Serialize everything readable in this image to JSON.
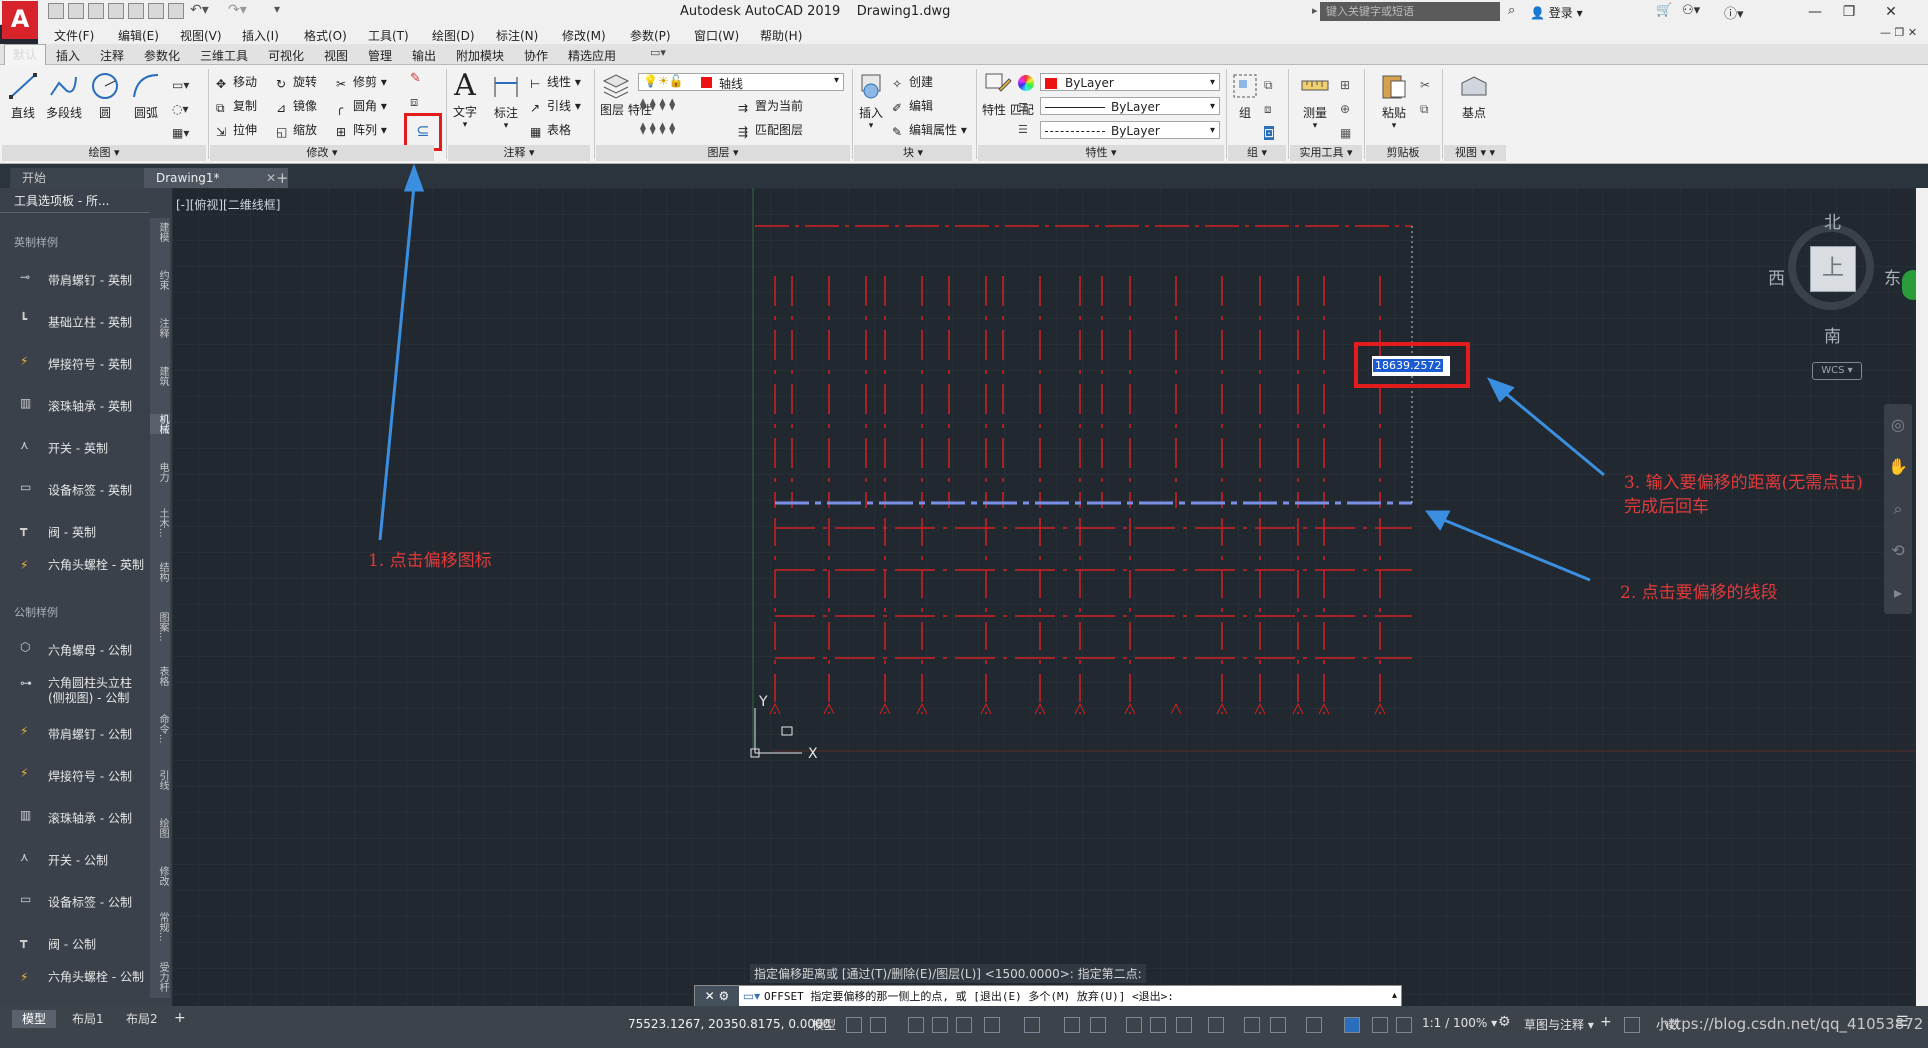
{
  "titlebar": {
    "app": "Autodesk AutoCAD 2019",
    "file": "Drawing1.dwg",
    "search_placeholder": "键入关键字或短语",
    "login": "登录"
  },
  "menu": [
    "文件(F)",
    "编辑(E)",
    "视图(V)",
    "插入(I)",
    "格式(O)",
    "工具(T)",
    "绘图(D)",
    "标注(N)",
    "修改(M)",
    "参数(P)",
    "窗口(W)",
    "帮助(H)"
  ],
  "ribbon_tabs": [
    "默认",
    "插入",
    "注释",
    "参数化",
    "三维工具",
    "可视化",
    "视图",
    "管理",
    "输出",
    "附加模块",
    "协作",
    "精选应用"
  ],
  "ribbon": {
    "draw": {
      "line": "直线",
      "polyline": "多段线",
      "circle": "圆",
      "arc": "圆弧",
      "title": "绘图"
    },
    "modify": {
      "move": "移动",
      "rotate": "旋转",
      "trim": "修剪",
      "copy": "复制",
      "mirror": "镜像",
      "fillet": "圆角",
      "stretch": "拉伸",
      "scale": "缩放",
      "array": "阵列",
      "title": "修改"
    },
    "annotation": {
      "text": "文字",
      "dimension": "标注",
      "linear": "线性",
      "leader": "引线",
      "table": "表格",
      "title": "注释"
    },
    "layers": {
      "properties": "图层\n特性",
      "current_layer": "轴线",
      "make_current": "置为当前",
      "match_layer": "匹配图层",
      "title": "图层"
    },
    "block": {
      "insert": "插入",
      "create": "创建",
      "edit": "编辑",
      "edit_attr": "编辑属性",
      "title": "块"
    },
    "properties": {
      "match": "特性\n匹配",
      "color": "ByLayer",
      "linetype": "ByLayer",
      "lineweight": "ByLayer",
      "title": "特性"
    },
    "groups": {
      "group": "组",
      "title": "组"
    },
    "utilities": {
      "measure": "测量",
      "title": "实用工具"
    },
    "clipboard": {
      "paste": "粘贴",
      "title": "剪贴板"
    },
    "view": {
      "base": "基点",
      "title": "视图"
    }
  },
  "file_tabs": [
    "开始",
    "Drawing1*"
  ],
  "viewport_label": "[-][俯视][二维线框]",
  "palette": {
    "title": "工具选项板 - 所...",
    "section_imperial": "英制样例",
    "imperial_items": [
      "带肩螺钉 - 英制",
      "基础立柱 - 英制",
      "焊接符号 - 英制",
      "滚珠轴承 - 英制",
      "开关 - 英制",
      "设备标签 - 英制",
      "阀 - 英制",
      "六角头螺栓 - 英制"
    ],
    "section_metric": "公制样例",
    "metric_items": [
      "六角螺母 - 公制",
      "六角圆柱头立柱 (侧视图) - 公制",
      "带肩螺钉 - 公制",
      "焊接符号 - 公制",
      "滚珠轴承 - 公制",
      "开关 - 公制",
      "设备标签 - 公制",
      "阀 - 公制",
      "六角头螺栓 - 公制"
    ],
    "vtabs": [
      "建模",
      "约束",
      "注释",
      "建筑",
      "机械",
      "电力",
      "土木...",
      "结构",
      "图案...",
      "表格",
      "命令...",
      "引线",
      "绘图",
      "修改",
      "常规...",
      "受力杆"
    ]
  },
  "viewcube": {
    "north": "北",
    "south": "南",
    "west": "西",
    "east": "东",
    "top": "上",
    "wcs": "WCS"
  },
  "dynamic_input": "18639.2572",
  "annotations": {
    "step1": "1. 点击偏移图标",
    "step2": "2. 点击要偏移的线段",
    "step3_line1": "3. 输入要偏移的距离(无需点击)",
    "step3_line2": "完成后回车"
  },
  "command": {
    "history": "指定偏移距离或 [通过(T)/删除(E)/图层(L)] <1500.0000>:  指定第二点:",
    "current": "OFFSET 指定要偏移的那一侧上的点, 或 [退出(E) 多个(M) 放弃(U)] <退出>:"
  },
  "status": {
    "layout_tabs": [
      "模型",
      "布局1",
      "布局2"
    ],
    "coords": "75523.1267, 20350.8175, 0.0000",
    "model": "模型",
    "scale": "1:1 / 100%",
    "workspace": "草图与注释",
    "units": "小数"
  },
  "watermark": "https://blog.csdn.net/qq_41053872",
  "colors": {
    "red_line": "#d22020",
    "annotation": "#e23a3a",
    "highlight_box": "#e21c1c",
    "arrow": "#3b8fe0"
  }
}
